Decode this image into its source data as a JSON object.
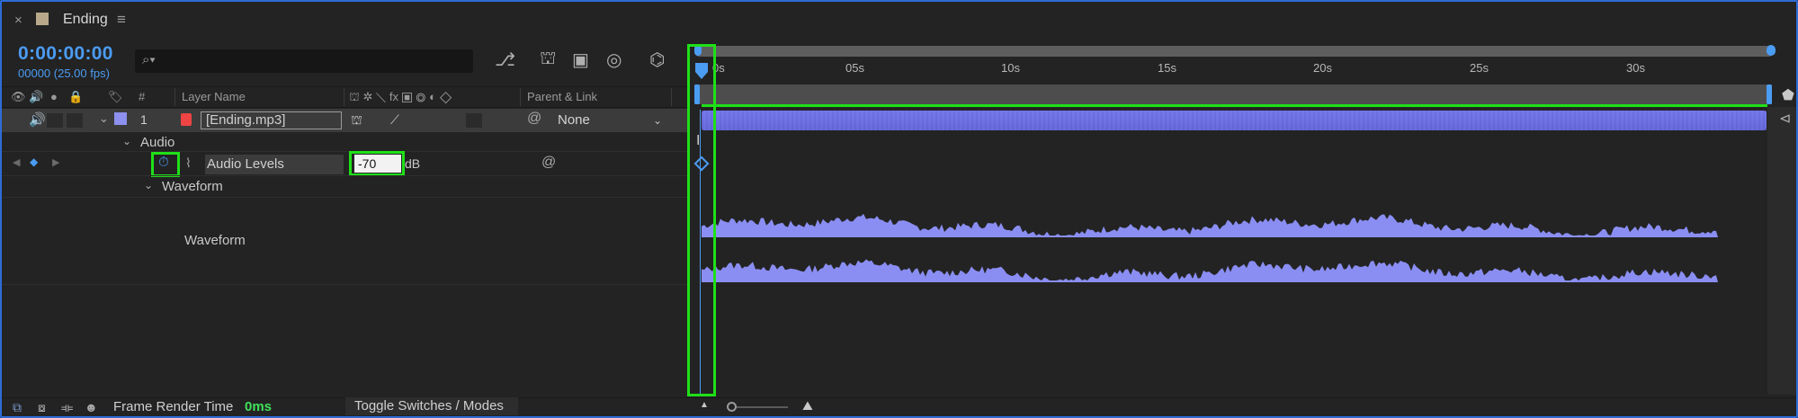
{
  "tab": {
    "close_glyph": "×",
    "title": "Ending",
    "menu_glyph": "≡"
  },
  "time": {
    "timecode": "0:00:00:00",
    "frame_fps": "00000 (25.00 fps)"
  },
  "search": {
    "placeholder": ""
  },
  "columns": {
    "number": "#",
    "layer_name": "Layer Name",
    "parent_link": "Parent & Link"
  },
  "layer": {
    "number": "1",
    "name": "[Ending.mp3]",
    "parent": "None"
  },
  "properties": {
    "audio": "Audio",
    "audio_levels": "Audio Levels",
    "audio_levels_value": "-70",
    "audio_levels_unit": "dB",
    "waveform_group": "Waveform",
    "waveform": "Waveform"
  },
  "ruler": [
    "05s",
    "10s",
    "15s",
    "20s",
    "25s",
    "30s"
  ],
  "ruler_start": "0s",
  "footer": {
    "frame_render_label": "Frame Render Time",
    "frame_render_value": "0ms",
    "toggle": "Toggle Switches / Modes"
  },
  "colors": {
    "accent": "#4b9cf3",
    "highlight": "#1fe018",
    "clip": "#7477e8",
    "label": "#8d90ee"
  }
}
